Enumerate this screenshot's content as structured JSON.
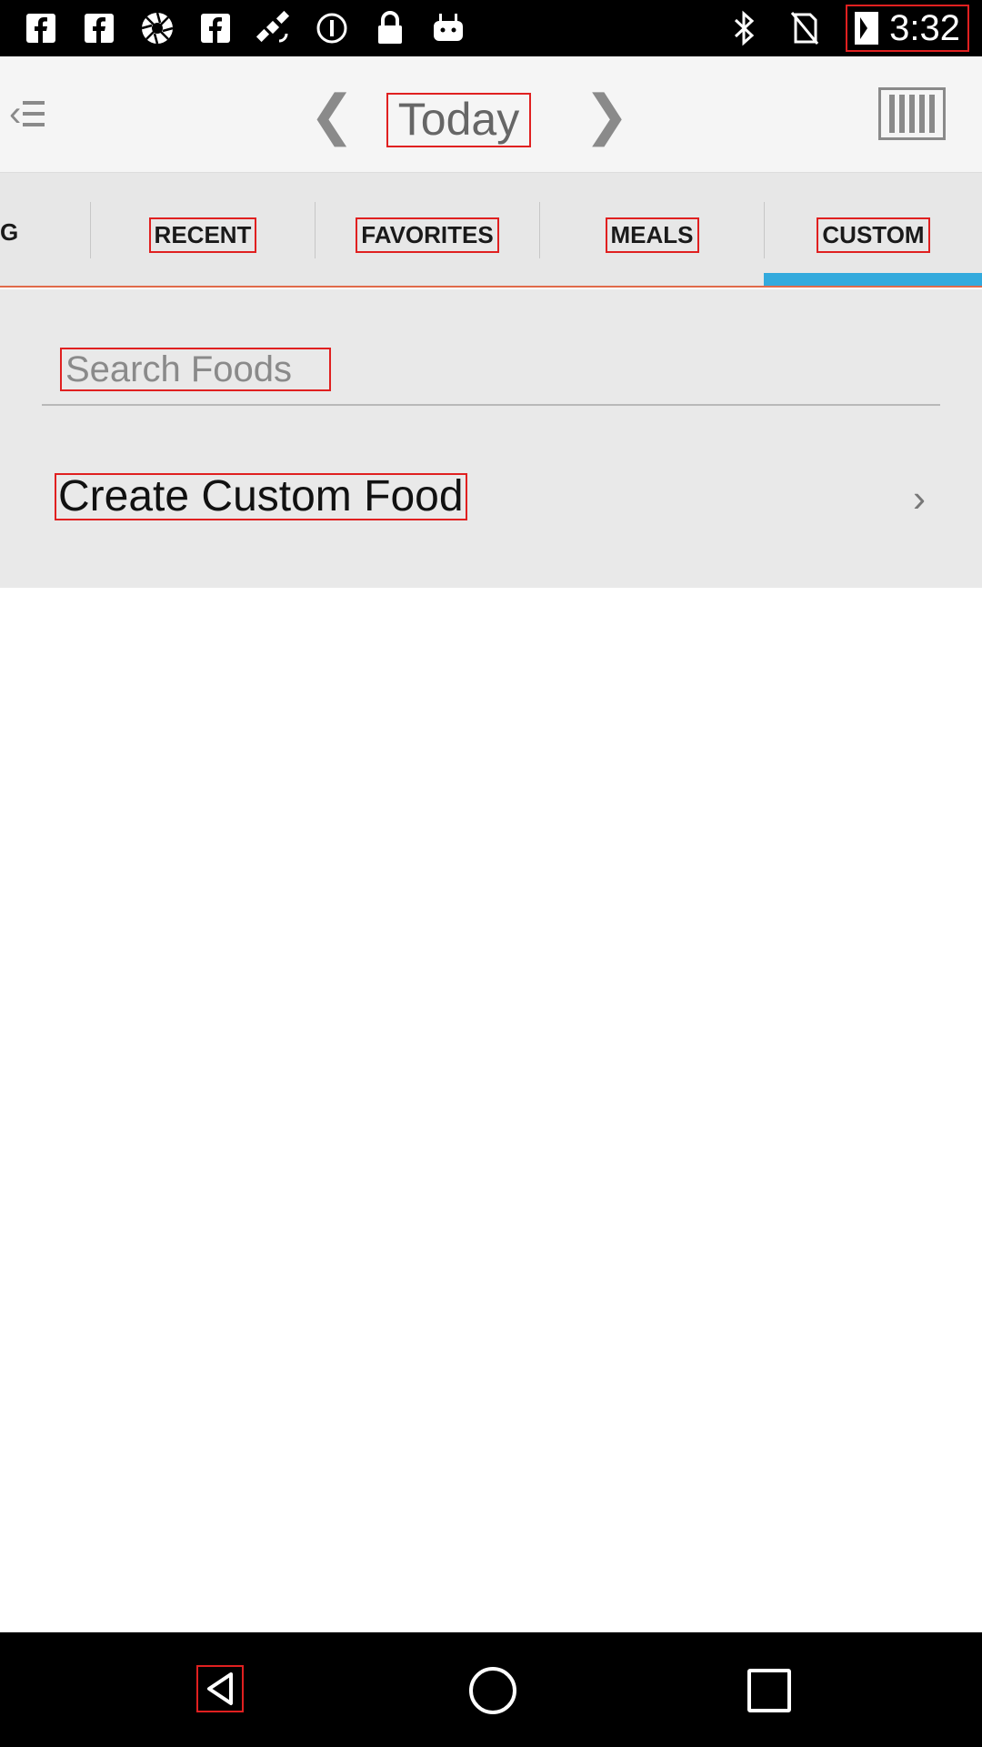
{
  "status_bar": {
    "time": "3:32",
    "left_icons": [
      "facebook-icon",
      "facebook-icon",
      "aperture-icon",
      "facebook-icon",
      "satellite-icon",
      "info-icon",
      "lock-icon",
      "android-icon"
    ],
    "right_icons": [
      "bluetooth-icon",
      "no-sim-icon",
      "battery-charging-icon"
    ]
  },
  "header": {
    "date_title": "Today",
    "icons": {
      "menu": "menu-icon",
      "prev": "chevron-left-icon",
      "next": "chevron-right-icon",
      "barcode": "barcode-icon"
    }
  },
  "tabs": {
    "partial_left": "G",
    "items": [
      {
        "label": "RECENT"
      },
      {
        "label": "FAVORITES"
      },
      {
        "label": "MEALS"
      },
      {
        "label": "CUSTOM"
      }
    ],
    "active_index": 3,
    "active_color": "#33aadd"
  },
  "search": {
    "placeholder": "Search Foods"
  },
  "custom": {
    "create_label": "Create Custom Food"
  },
  "nav_bar": {
    "icons": [
      "back-icon",
      "home-icon",
      "recent-apps-icon"
    ]
  }
}
